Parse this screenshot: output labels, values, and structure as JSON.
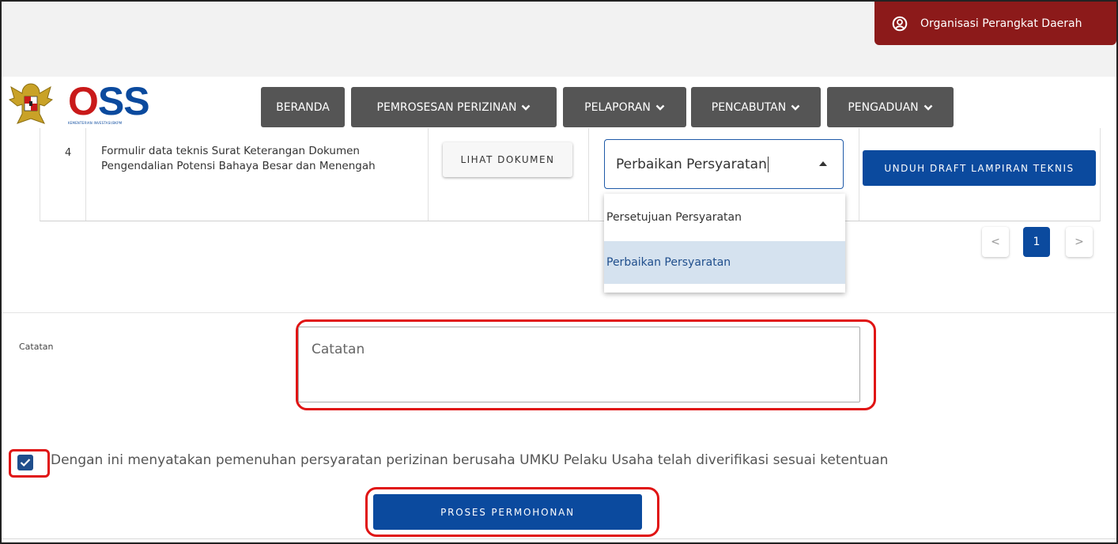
{
  "header": {
    "user_role": "Organisasi Perangkat Daerah",
    "user_icon": "user-circle-icon",
    "brand_colors": {
      "primary_blue": "#0b4a9e",
      "badge_red": "#8c1a1a",
      "nav_gray": "#555555",
      "highlight_red": "#e01414"
    }
  },
  "logo": {
    "text": "OSS",
    "subtitle": "KEMENTERIAN INVESTASI/BKPM"
  },
  "nav": {
    "items": [
      {
        "label": "BERANDA",
        "chevron": false
      },
      {
        "label": "PEMROSESAN PERIZINAN",
        "chevron": true
      },
      {
        "label": "PELAPORAN",
        "chevron": true
      },
      {
        "label": "PENCABUTAN",
        "chevron": true
      },
      {
        "label": "PENGADUAN",
        "chevron": true
      }
    ],
    "chevron_glyph": "❯"
  },
  "document_row": {
    "number": "4",
    "name": "Formulir data teknis Surat Keterangan Dokumen Pengendalian Potensi Bahaya Besar dan Menengah",
    "view_button": "LIHAT DOKUMEN",
    "status_select": {
      "value": "Perbaikan Persyaratan",
      "options": [
        "Persetujuan Persyaratan",
        "Perbaikan Persyaratan"
      ],
      "selected_index": 1
    },
    "download_button": "UNDUH DRAFT LAMPIRAN TEKNIS"
  },
  "pagination": {
    "prev": "<",
    "current": "1",
    "next": ">"
  },
  "form": {
    "catatan_label": "Catatan",
    "catatan_placeholder": "Catatan",
    "catatan_value": "",
    "declaration_checked": true,
    "declaration_text": "Dengan ini menyatakan pemenuhan persyaratan perizinan berusaha UMKU Pelaku Usaha telah diverifikasi sesuai ketentuan",
    "submit_button": "PROSES PERMOHONAN"
  }
}
